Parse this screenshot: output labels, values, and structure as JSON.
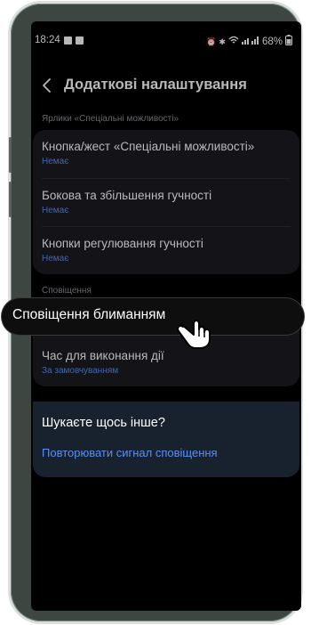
{
  "status_bar": {
    "time": "18:24",
    "battery": "68%"
  },
  "header": {
    "title": "Додаткові налаштування"
  },
  "shortcuts_section": {
    "label": "Ярлики «Спеціальні можливості»",
    "items": [
      {
        "title": "Кнопка/жест «Спеціальні можливості»",
        "subtitle": "Немає"
      },
      {
        "title": "Бокова та збільшення гучності",
        "subtitle": "Немає"
      },
      {
        "title": "Кнопки регулювання гучності",
        "subtitle": "Немає"
      }
    ]
  },
  "notifications_section": {
    "label": "Сповіщення",
    "items": [
      {
        "title": "Час для виконання дії",
        "subtitle": "За замовчуванням"
      }
    ]
  },
  "callout": {
    "label": "Сповіщення блиманням"
  },
  "suggestions": {
    "title": "Шукаєте щось інше?",
    "link": "Повторювати сигнал сповіщення"
  },
  "colors": {
    "background": "#000000",
    "card": "#1c1d22",
    "accent": "#5b8ef0",
    "suggest_card": "#18222f",
    "phone_frame": "#3d4641"
  },
  "icons": [
    "message-icon",
    "image-icon",
    "alarm-icon",
    "bluetooth-icon",
    "wifi-icon",
    "signal-icon",
    "battery-icon",
    "back-arrow-icon",
    "hand-pointer-icon"
  ]
}
